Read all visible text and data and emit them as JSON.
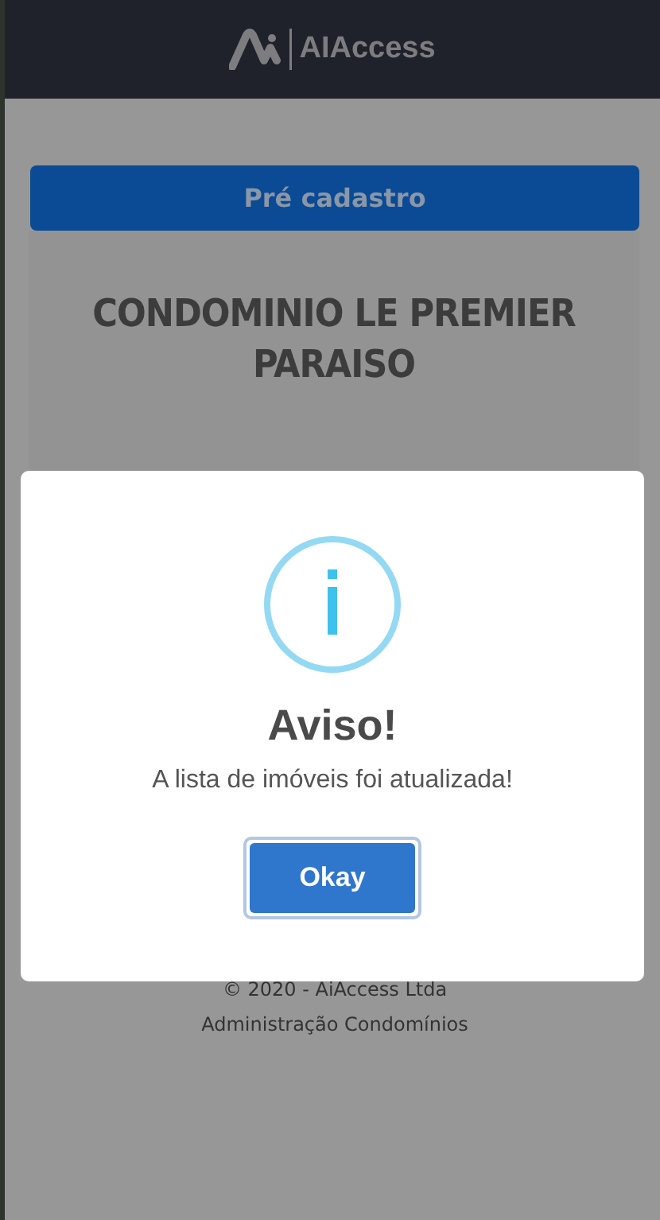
{
  "header": {
    "logo_text": "AIAccess"
  },
  "pre_register_button": {
    "label": "Pré cadastro"
  },
  "card": {
    "title": "CONDOMINIO LE PREMIER PARAISO"
  },
  "footer": {
    "lines": [
      "© 2020 - AiAccess Ltda",
      "Administração Condomínios"
    ]
  },
  "modal": {
    "kind": "info",
    "title": "Aviso!",
    "message": "A lista de imóveis foi atualizada!",
    "button": "Okay"
  }
}
